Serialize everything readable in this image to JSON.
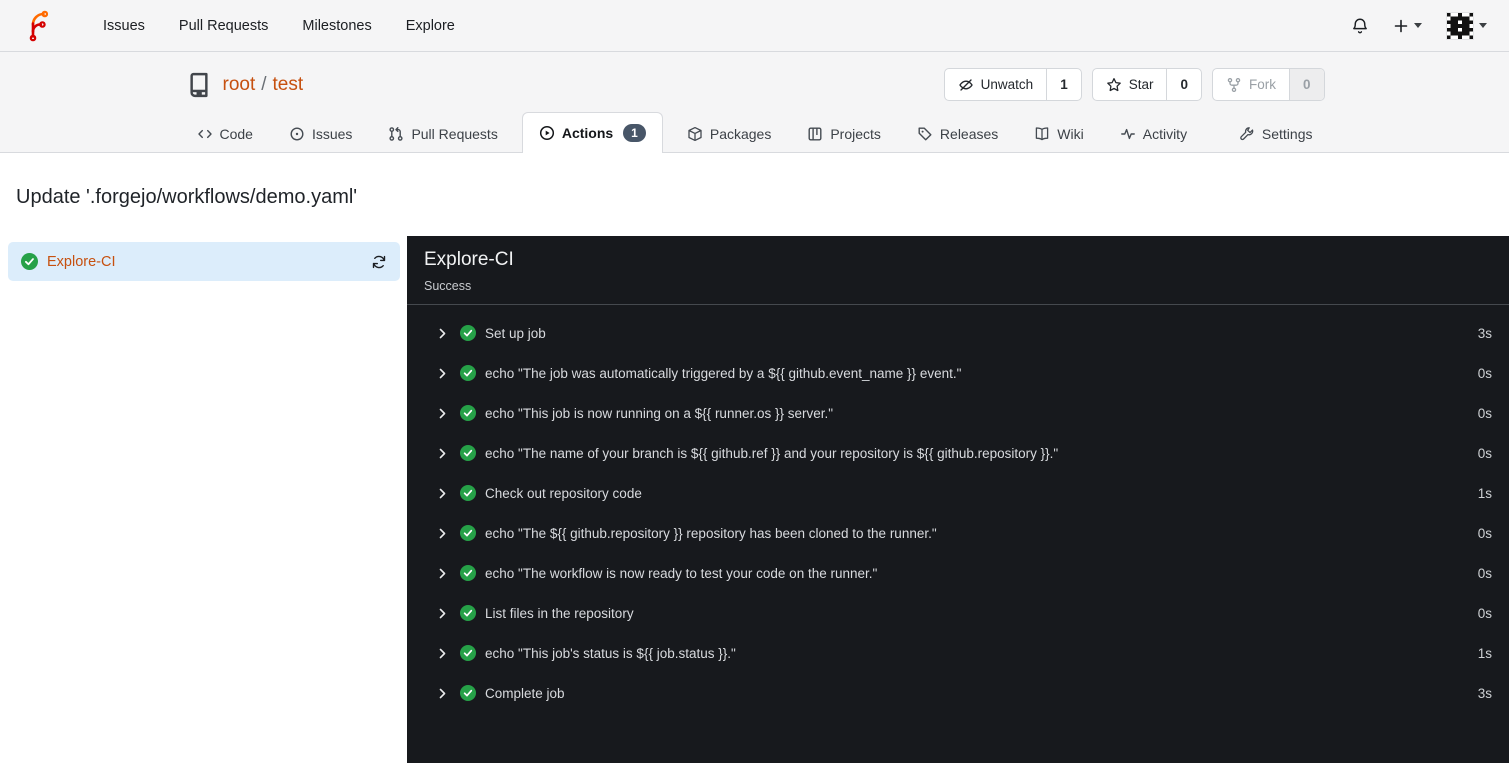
{
  "colors": {
    "primary": "#c6500f",
    "success": "#26a148",
    "panel-bg": "#17191d",
    "nav-bg": "#f5f5f6",
    "border": "#d8dade",
    "badge-bg": "#485668",
    "job-sel-bg": "#dcedfb"
  },
  "navbar": {
    "logo_icon": "forgejo-logo",
    "items": [
      {
        "label": "Issues"
      },
      {
        "label": "Pull Requests"
      },
      {
        "label": "Milestones"
      },
      {
        "label": "Explore"
      }
    ],
    "right_icons": [
      "bell-icon",
      "plus-icon",
      "avatar-identicon"
    ]
  },
  "repo": {
    "owner": "root",
    "separator": "/",
    "name": "test",
    "actions": [
      {
        "label": "Unwatch",
        "count": "1",
        "icon": "eye-slash-icon"
      },
      {
        "label": "Star",
        "count": "0",
        "icon": "star-icon"
      },
      {
        "label": "Fork",
        "count": "0",
        "icon": "fork-icon",
        "disabled": true
      }
    ]
  },
  "tabs": [
    {
      "label": "Code",
      "icon": "code-icon"
    },
    {
      "label": "Issues",
      "icon": "issue-icon"
    },
    {
      "label": "Pull Requests",
      "icon": "pull-request-icon"
    },
    {
      "label": "Actions",
      "icon": "play-circle-icon",
      "badge": "1",
      "active": true
    },
    {
      "label": "Packages",
      "icon": "package-icon"
    },
    {
      "label": "Projects",
      "icon": "project-icon"
    },
    {
      "label": "Releases",
      "icon": "tag-icon"
    },
    {
      "label": "Wiki",
      "icon": "book-icon"
    },
    {
      "label": "Activity",
      "icon": "pulse-icon"
    },
    {
      "label": "Settings",
      "icon": "tools-icon"
    }
  ],
  "run": {
    "title": "Update '.forgejo/workflows/demo.yaml'"
  },
  "sidebar": {
    "job": {
      "name": "Explore-CI",
      "status": "success",
      "refresh_icon": "sync-icon"
    }
  },
  "panel": {
    "title": "Explore-CI",
    "status": "Success",
    "steps": [
      {
        "name": "Set up job",
        "duration": "3s"
      },
      {
        "name": "echo \"The job was automatically triggered by a ${{ github.event_name }} event.\"",
        "duration": "0s"
      },
      {
        "name": "echo \"This job is now running on a ${{ runner.os }} server.\"",
        "duration": "0s"
      },
      {
        "name": "echo \"The name of your branch is ${{ github.ref }} and your repository is ${{ github.repository }}.\"",
        "duration": "0s"
      },
      {
        "name": "Check out repository code",
        "duration": "1s"
      },
      {
        "name": "echo \"The ${{ github.repository }} repository has been cloned to the runner.\"",
        "duration": "0s"
      },
      {
        "name": "echo \"The workflow is now ready to test your code on the runner.\"",
        "duration": "0s"
      },
      {
        "name": "List files in the repository",
        "duration": "0s"
      },
      {
        "name": "echo \"This job's status is ${{ job.status }}.\"",
        "duration": "1s"
      },
      {
        "name": "Complete job",
        "duration": "3s"
      }
    ]
  }
}
